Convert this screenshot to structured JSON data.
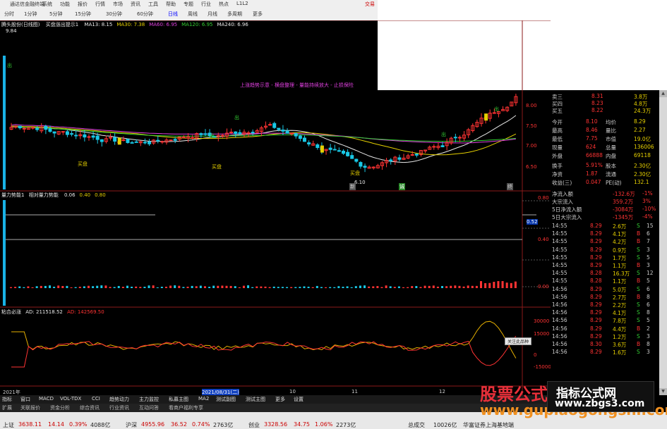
{
  "window": {
    "title": "通达信金融终端",
    "right_label": "交易",
    "menu": [
      "系统",
      "功能",
      "报价",
      "行情",
      "市场",
      "资讯",
      "工具",
      "帮助",
      "专题",
      "行业",
      "热点",
      "L1L2"
    ]
  },
  "periods": {
    "items": [
      "分时",
      "1分钟",
      "5分钟",
      "15分钟",
      "30分钟",
      "60分钟",
      "日线",
      "周线",
      "月线",
      "多周期",
      "更多"
    ],
    "selected_index": 6
  },
  "main_panel": {
    "stock_name": "腾头股份(日线图)",
    "indicator_name": "买盘涨出提示1",
    "ma_labels": [
      {
        "text": "MA13: 8.15",
        "color": "#e8e8e8"
      },
      {
        "text": "MA30: 7.38",
        "color": "#e6d000"
      },
      {
        "text": "MA60: 6.95",
        "color": "#e040e0"
      },
      {
        "text": "MA120: 6.95",
        "color": "#33cc33"
      },
      {
        "text": "MA240: 6.96",
        "color": "#e8e8e8"
      }
    ],
    "high_label": "9.84",
    "annotation": "上涨趋势示意 - 横盘整理 - 量能持续放大 - 止损保险",
    "signals": [
      {
        "text": "买盘",
        "color": "#e6d000"
      },
      {
        "text": "买盘",
        "color": "#e6d000"
      },
      {
        "text": "买盘",
        "color": "#e6d000"
      },
      {
        "text": "出",
        "color": "#33cc33"
      },
      {
        "text": "出",
        "color": "#33cc33"
      },
      {
        "text": "出",
        "color": "#33cc33"
      },
      {
        "text": "出",
        "color": "#33cc33"
      },
      {
        "text": "出",
        "color": "#33cc33"
      }
    ],
    "low_label": "6.10",
    "price_axis": [
      "8.00",
      "7.50",
      "7.00",
      "6.50"
    ],
    "bottom_markers": [
      "新",
      "诚",
      "终"
    ]
  },
  "sub_panel1": {
    "title": "量力势能1",
    "subtitle": "相对量力势能",
    "values": [
      {
        "text": "0.06",
        "color": "#e8e8e8"
      },
      {
        "text": "0.40",
        "color": "#e6d000"
      },
      {
        "text": "0.80",
        "color": "#e6d000"
      }
    ],
    "axis": [
      "0.80",
      "0.52",
      "0.40",
      "0.00"
    ],
    "highlight_value": "0.52"
  },
  "sub_panel2": {
    "title": "粘合必涨",
    "ad_label": "AD: 211518.52",
    "ad_ma_label": "AD: 142569.50",
    "axis": [
      "30000",
      "15000",
      "0",
      "-15000"
    ]
  },
  "timeline": {
    "labels": [
      "2021年",
      "2021/08/31(二)",
      "10",
      "11",
      "12"
    ],
    "highlight_index": 1
  },
  "right_panel": {
    "quotes": [
      {
        "label": "卖三",
        "price": "8.31",
        "volume": "3.8万"
      },
      {
        "label": "买四",
        "price": "8.23",
        "volume": "4.8万"
      },
      {
        "label": "买五",
        "price": "8.22",
        "volume": "24.3万"
      }
    ],
    "stats": [
      {
        "l1": "今开",
        "v1": "8.10",
        "l2": "均价",
        "v2": "8.29"
      },
      {
        "l1": "最高",
        "v1": "8.46",
        "l2": "量比",
        "v2": "2.27"
      },
      {
        "l1": "最低",
        "v1": "7.75",
        "l2": "市值",
        "v2": "19.0亿"
      },
      {
        "l1": "现量",
        "v1": "624",
        "l2": "总量",
        "v2": "136006"
      },
      {
        "l1": "外盘",
        "v1": "66888",
        "l2": "内盘",
        "v2": "69118"
      },
      {
        "l1": "换手",
        "v1": "5.91%",
        "l2": "股本",
        "v2": "2.30亿"
      },
      {
        "l1": "净资",
        "v1": "1.87",
        "l2": "流通",
        "v2": "2.30亿"
      },
      {
        "l1": "收益(三)",
        "v1": "0.047",
        "l2": "PE(动)",
        "v2": "132.1"
      }
    ],
    "flows": [
      {
        "label": "净流入额",
        "value": "-132.6万",
        "pct": "-1%"
      },
      {
        "label": "大宗流入",
        "value": "359.2万",
        "pct": "3%"
      },
      {
        "label": "5日净流入额",
        "value": "-3084万",
        "pct": "-10%"
      },
      {
        "label": "5日大宗流入",
        "value": "-1345万",
        "pct": "-4%"
      }
    ],
    "ticks": [
      {
        "time": "14:55",
        "price": "8.29",
        "vol": "2.6万",
        "dir": "S",
        "n": "15"
      },
      {
        "time": "14:55",
        "price": "8.29",
        "vol": "4.1万",
        "dir": "B",
        "n": "6"
      },
      {
        "time": "14:55",
        "price": "8.29",
        "vol": "4.2万",
        "dir": "B",
        "n": "7"
      },
      {
        "time": "14:55",
        "price": "8.29",
        "vol": "0.9万",
        "dir": "S",
        "n": "3"
      },
      {
        "time": "14:55",
        "price": "8.29",
        "vol": "1.7万",
        "dir": "S",
        "n": "5"
      },
      {
        "time": "14:55",
        "price": "8.29",
        "vol": "1.1万",
        "dir": "B",
        "n": "3"
      },
      {
        "time": "14:55",
        "price": "8.28",
        "vol": "16.3万",
        "dir": "S",
        "n": "12"
      },
      {
        "time": "14:55",
        "price": "8.28",
        "vol": "1.1万",
        "dir": "B",
        "n": "5"
      },
      {
        "time": "14:56",
        "price": "8.29",
        "vol": "5.0万",
        "dir": "S",
        "n": "6"
      },
      {
        "time": "14:56",
        "price": "8.29",
        "vol": "2.7万",
        "dir": "B",
        "n": "8"
      },
      {
        "time": "14:56",
        "price": "8.29",
        "vol": "2.2万",
        "dir": "S",
        "n": "6"
      },
      {
        "time": "14:56",
        "price": "8.29",
        "vol": "4.1万",
        "dir": "S",
        "n": "8"
      },
      {
        "time": "14:56",
        "price": "8.29",
        "vol": "7.8万",
        "dir": "S",
        "n": "5"
      },
      {
        "time": "14:56",
        "price": "8.29",
        "vol": "4.4万",
        "dir": "B",
        "n": "2"
      },
      {
        "time": "14:56",
        "price": "8.29",
        "vol": "1.2万",
        "dir": "S",
        "n": "3"
      },
      {
        "time": "14:56",
        "price": "8.30",
        "vol": "3.6万",
        "dir": "B",
        "n": "8"
      },
      {
        "time": "14:56",
        "price": "8.29",
        "vol": "1.6万",
        "dir": "S",
        "n": "3"
      }
    ]
  },
  "tooltip": "关注此品种",
  "bottom_tabs_1": [
    "指标",
    "窗口",
    "MACD",
    "VOL-TDX",
    "CCI",
    "趋势动力",
    "主力监控",
    "私募主图",
    "MA2",
    "测试副图",
    "测试主图",
    "更多",
    "设置"
  ],
  "bottom_tabs_2": [
    "扩展",
    "关联报价",
    "资金分析",
    "综合资讯",
    "行业资讯",
    "互动问答",
    "看商户福利专享"
  ],
  "status_bar": {
    "items": [
      {
        "label": "上证",
        "value": "3638.11",
        "change": "14.14",
        "pct": "0.39%",
        "amount": "4088亿"
      },
      {
        "label": "沪深",
        "value": "4955.96",
        "change": "36.52",
        "pct": "0.74%",
        "amount": "2763亿"
      },
      {
        "label": "创业",
        "value": "3328.56",
        "change": "34.75",
        "pct": "1.06%",
        "amount": "2273亿"
      }
    ],
    "total_label": "总成交",
    "total_value": "10026亿",
    "extra": "华富证券上海基地端"
  },
  "watermark": {
    "left_text": "股票公式网",
    "left_url": "www.gupiaogongshi.com",
    "box_title": "指标公式网",
    "box_url": "www.zbgs3.com"
  }
}
